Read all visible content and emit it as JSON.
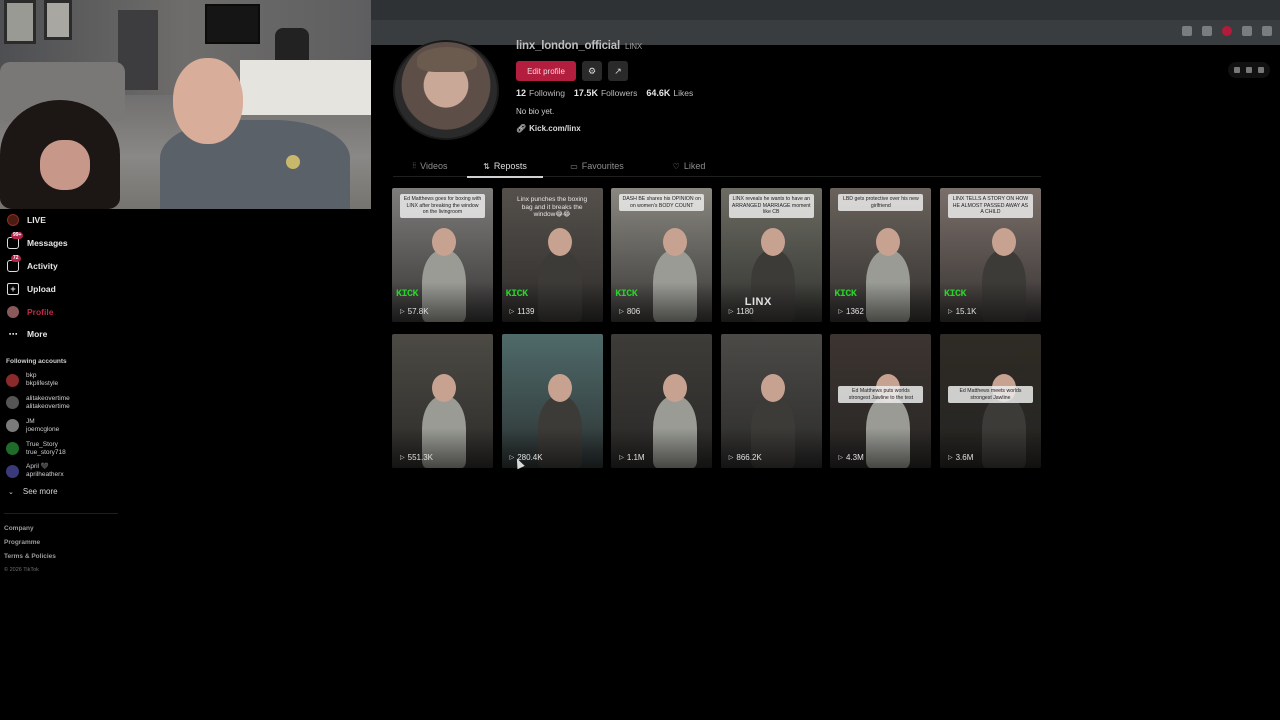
{
  "sidebar": {
    "nav": [
      {
        "label": "LIVE",
        "icon": "live-icon"
      },
      {
        "label": "Messages",
        "icon": "messages-icon",
        "badge": "99+"
      },
      {
        "label": "Activity",
        "icon": "activity-icon",
        "badge": "72"
      },
      {
        "label": "Upload",
        "icon": "upload-icon"
      },
      {
        "label": "Profile",
        "icon": "profile-avatar-icon",
        "active": true
      },
      {
        "label": "More",
        "icon": "more-icon"
      }
    ],
    "following_title": "Following accounts",
    "following": [
      {
        "name": "bkp",
        "handle": "bkplifestyle",
        "color": "#8a2a2a"
      },
      {
        "name": "alitakeovertime",
        "handle": "alitakeovertime",
        "color": "#555555"
      },
      {
        "name": "JM",
        "handle": "joemcglone",
        "color": "#7a7a7a"
      },
      {
        "name": "True_Story",
        "handle": "true_story718",
        "color": "#1f6b2a"
      },
      {
        "name": "April 🖤",
        "handle": "aprilheatherx",
        "color": "#3a3a7a"
      }
    ],
    "see_more": "See more",
    "footer_links": [
      "Company",
      "Programme",
      "Terms & Policies"
    ],
    "copyright": "© 2026 TikTok"
  },
  "profile": {
    "username": "linx_london_official",
    "nickname": "LINX",
    "edit_label": "Edit profile",
    "stats": [
      {
        "value": "12",
        "label": "Following"
      },
      {
        "value": "17.5K",
        "label": "Followers"
      },
      {
        "value": "64.6K",
        "label": "Likes"
      }
    ],
    "bio": "No bio yet.",
    "link": "Kick.com/linx"
  },
  "tabs": [
    {
      "label": "Videos",
      "icon": "grid-icon"
    },
    {
      "label": "Reposts",
      "icon": "repost-icon",
      "active": true
    },
    {
      "label": "Favourites",
      "icon": "bookmark-icon"
    },
    {
      "label": "Liked",
      "icon": "heart-outline-icon"
    }
  ],
  "videos": [
    {
      "caption": "Ed Matthews goes for boxing with LINX after breaking the window on the livingroom",
      "views": "57.8K",
      "kick": "KICK",
      "bg": "#7f7d7b"
    },
    {
      "caption": "Linx punches the boxing bag and it breaks the window😂😂",
      "views": "1139",
      "kick": "KICK",
      "bg": "#55504b",
      "plain": true
    },
    {
      "caption": "DASH BE shares his OPINION on on women's BODY COUNT",
      "views": "806",
      "kick": "KICK",
      "bg": "#8a8780"
    },
    {
      "caption": "LINX reveals he wants to have an ARRANGED MARRIAGE moment like CB",
      "views": "1180",
      "linx": "LINX",
      "bg": "#6c6c63"
    },
    {
      "caption": "LBD gets protective over his new girlfriend",
      "views": "1362",
      "kick": "KICK",
      "bg": "#6a625c"
    },
    {
      "caption": "LINX TELLS A STORY ON HOW HE ALMOST PASSED AWAY AS A CHILD",
      "views": "15.1K",
      "kick": "KICK",
      "bg": "#7b6f6a"
    },
    {
      "caption": "",
      "views": "551.3K",
      "bg": "#4c4a43"
    },
    {
      "caption": "",
      "views": "280.4K",
      "bg": "#4f6a6a"
    },
    {
      "caption": "",
      "views": "1.1M",
      "bg": "#3e3c38"
    },
    {
      "caption": "",
      "views": "866.2K",
      "bg": "#4b4a47"
    },
    {
      "caption": "Ed Matthews puts worlds strongest Jawline to the test",
      "views": "4.3M",
      "bg": "#3c3430"
    },
    {
      "caption": "Ed Matthews meets worlds strongest Jawline",
      "views": "3.6M",
      "bg": "#2f2b25"
    }
  ]
}
